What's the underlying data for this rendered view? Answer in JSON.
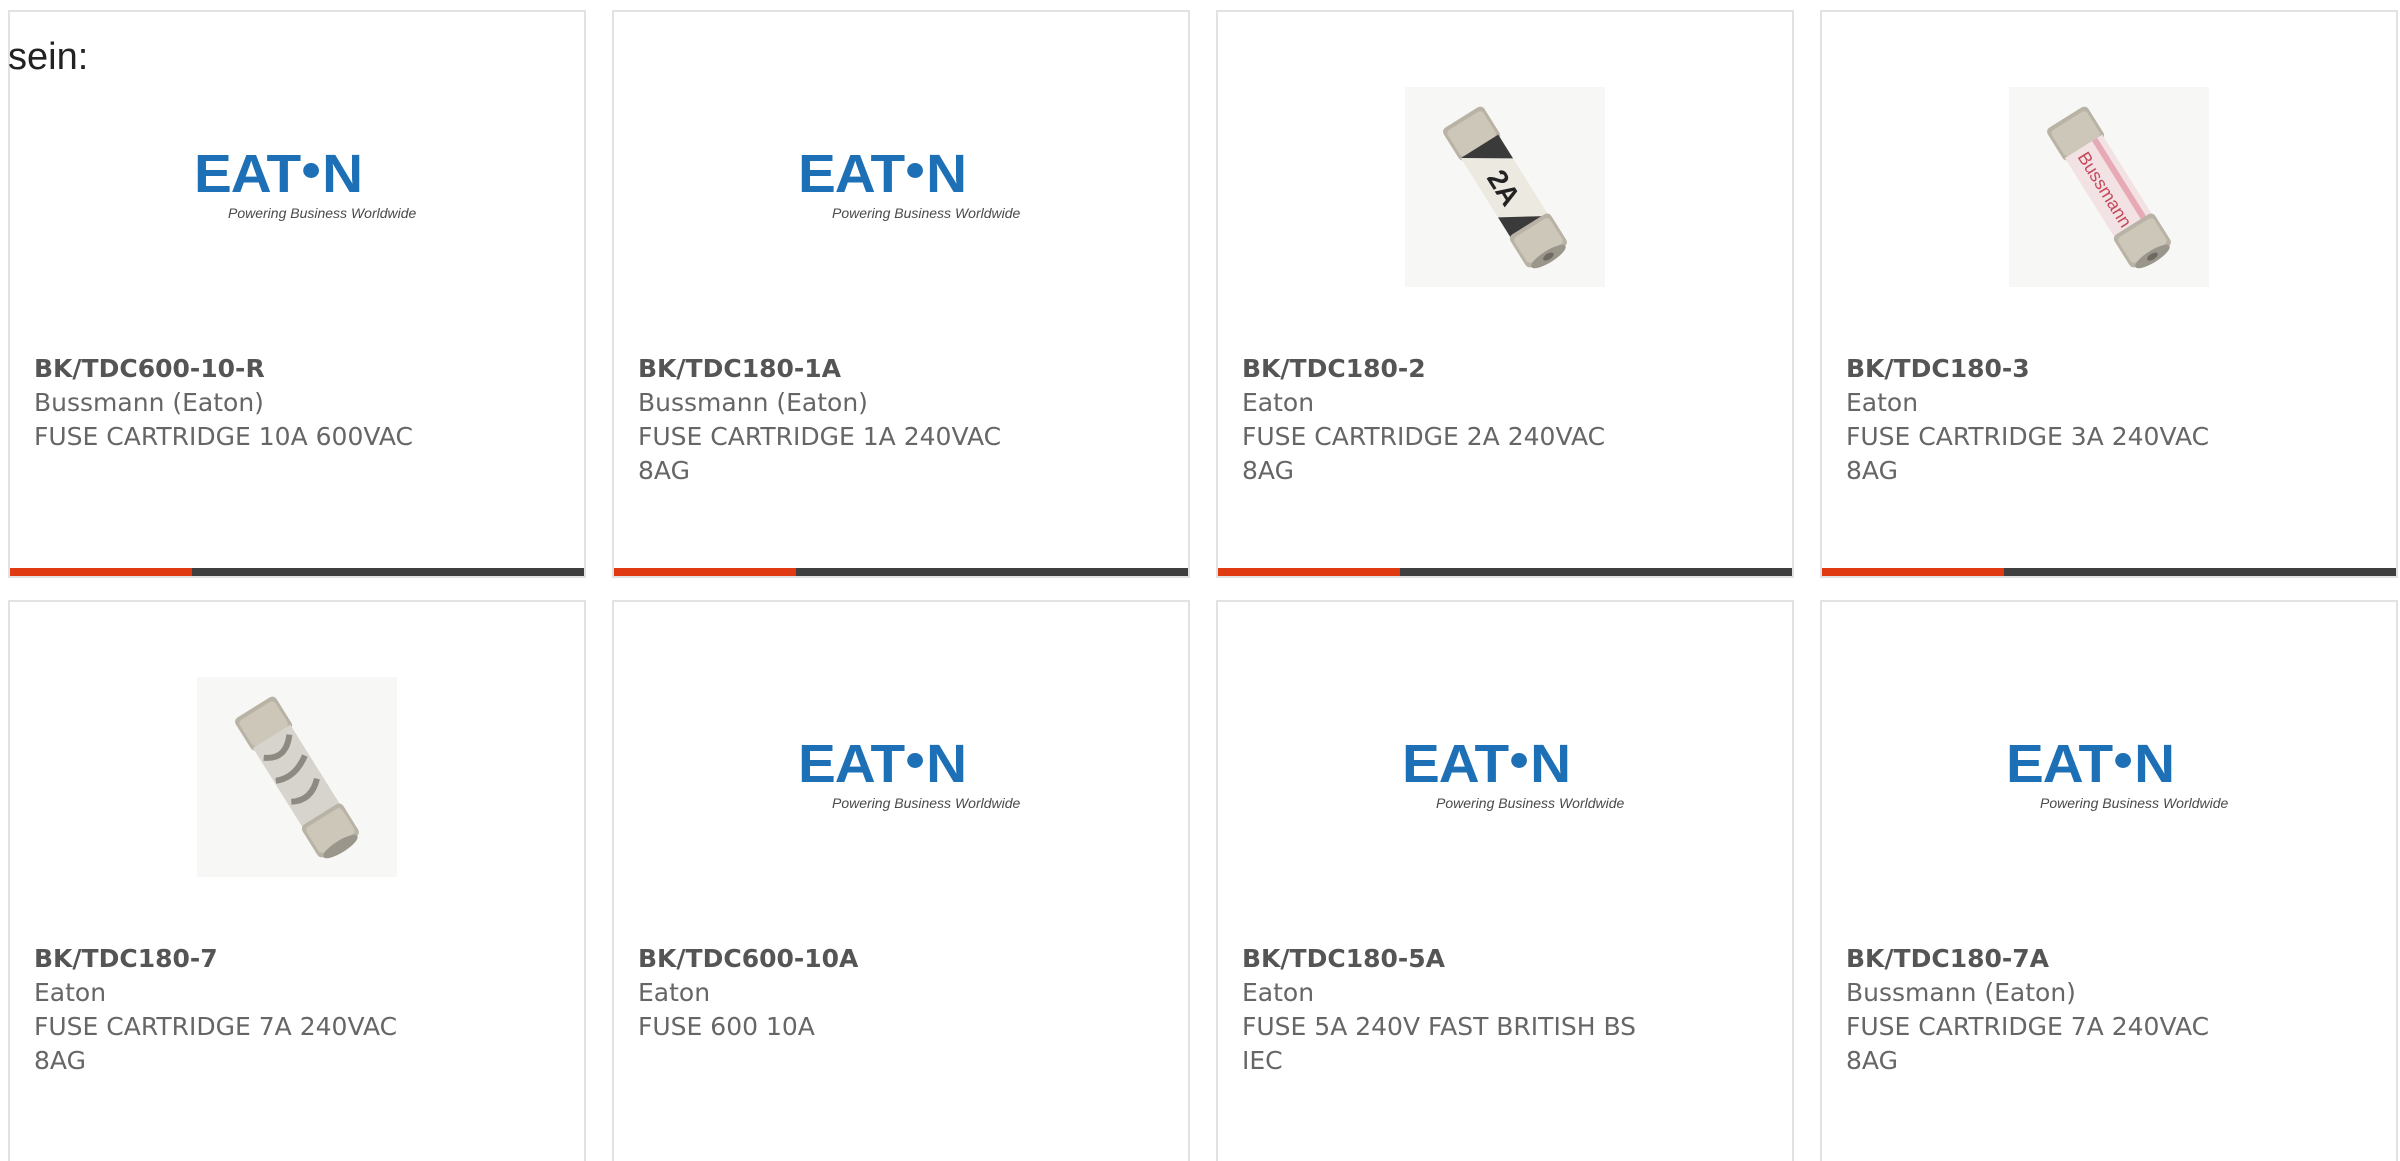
{
  "prefix_text": "sein:",
  "colors": {
    "accent": "#e03a12",
    "bar_dark": "#3f3f3f",
    "eaton_blue": "#1d6fb6"
  },
  "products": [
    {
      "part_number": "BK/TDC600-10-R",
      "manufacturer": "Bussmann (Eaton)",
      "description": "FUSE CARTRIDGE 10A 600VAC",
      "description2": "",
      "image": "eaton-logo",
      "fuse_label": ""
    },
    {
      "part_number": "BK/TDC180-1A",
      "manufacturer": "Bussmann (Eaton)",
      "description": "FUSE CARTRIDGE 1A 240VAC",
      "description2": "8AG",
      "image": "eaton-logo",
      "fuse_label": ""
    },
    {
      "part_number": "BK/TDC180-2",
      "manufacturer": "Eaton",
      "description": "FUSE CARTRIDGE 2A 240VAC",
      "description2": "8AG",
      "image": "fuse-photo",
      "fuse_label": "2A"
    },
    {
      "part_number": "BK/TDC180-3",
      "manufacturer": "Eaton",
      "description": "FUSE CARTRIDGE 3A 240VAC",
      "description2": "8AG",
      "image": "fuse-photo-red",
      "fuse_label": "Bussmann"
    },
    {
      "part_number": "BK/TDC180-7",
      "manufacturer": "Eaton",
      "description": "FUSE CARTRIDGE 7A 240VAC",
      "description2": "8AG",
      "image": "fuse-photo-gray",
      "fuse_label": ""
    },
    {
      "part_number": "BK/TDC600-10A",
      "manufacturer": "Eaton",
      "description": "FUSE 600 10A",
      "description2": "",
      "image": "eaton-logo",
      "fuse_label": ""
    },
    {
      "part_number": "BK/TDC180-5A",
      "manufacturer": "Eaton",
      "description": "FUSE 5A 240V FAST BRITISH BS",
      "description2": "IEC",
      "image": "eaton-logo",
      "fuse_label": ""
    },
    {
      "part_number": "BK/TDC180-7A",
      "manufacturer": "Bussmann (Eaton)",
      "description": "FUSE CARTRIDGE 7A 240VAC",
      "description2": "8AG",
      "image": "eaton-logo",
      "fuse_label": ""
    }
  ],
  "logo": {
    "word_left": "E",
    "word_mid": "A",
    "word_t": "T",
    "word_right": "N",
    "tagline": "Powering Business Worldwide"
  }
}
